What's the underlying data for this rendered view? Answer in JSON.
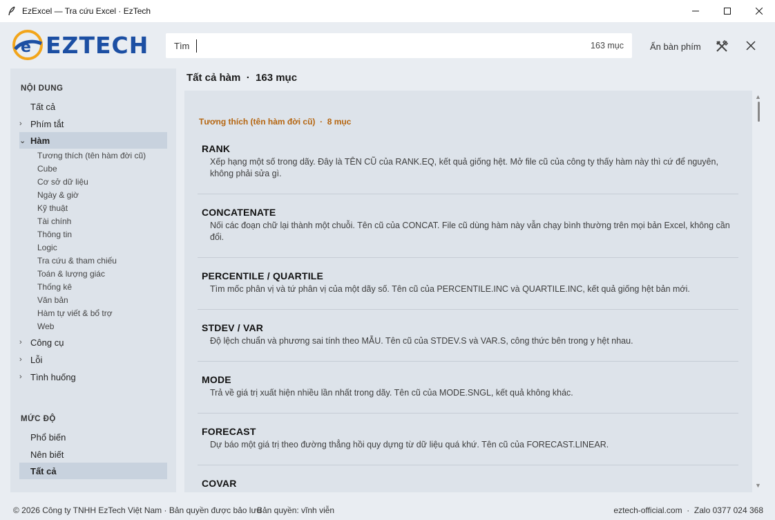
{
  "window": {
    "title": "EzExcel — Tra cứu Excel · EzTech"
  },
  "header": {
    "logo_text": "EZTECH",
    "search_label": "Tìm",
    "search_value": "",
    "search_count": "163 mục",
    "hide_keyboard": "Ẩn bàn phím"
  },
  "sidebar": {
    "content_label": "NỘI DUNG",
    "items": [
      {
        "label": "Tất cả",
        "chevron": ""
      },
      {
        "label": "Phím tắt",
        "chevron": "›"
      },
      {
        "label": "Hàm",
        "chevron": "⌄"
      },
      {
        "label": "Công cụ",
        "chevron": "›"
      },
      {
        "label": "Lỗi",
        "chevron": "›"
      },
      {
        "label": "Tình huống",
        "chevron": "›"
      }
    ],
    "sub_items": [
      "Tương thích (tên hàm đời cũ)",
      "Cube",
      "Cơ sở dữ liệu",
      "Ngày & giờ",
      "Kỹ thuật",
      "Tài chính",
      "Thông tin",
      "Logic",
      "Tra cứu & tham chiếu",
      "Toán & lượng giác",
      "Thống kê",
      "Văn bản",
      "Hàm tự viết & bổ trợ",
      "Web"
    ],
    "level_label": "MỨC ĐỘ",
    "levels": [
      "Phổ biến",
      "Nên biết",
      "Tất cả"
    ]
  },
  "main": {
    "title": "Tất cả hàm  ·  163 mục",
    "group_header": "Tương thích (tên hàm đời cũ)  ·  8 mục",
    "entries": [
      {
        "name": "RANK",
        "desc": "Xếp hạng một số trong dãy. Đây là TÊN CŨ của RANK.EQ, kết quả giống hệt. Mở file cũ của công ty thấy hàm này thì cứ để nguyên, không phải sửa gì."
      },
      {
        "name": "CONCATENATE",
        "desc": "Nối các đoạn chữ lại thành một chuỗi. Tên cũ của CONCAT. File cũ dùng hàm này vẫn chạy bình thường trên mọi bản Excel, không cần đổi."
      },
      {
        "name": "PERCENTILE / QUARTILE",
        "desc": "Tìm mốc phân vị và tứ phân vị của một dãy số. Tên cũ của PERCENTILE.INC và QUARTILE.INC, kết quả giống hệt bản mới."
      },
      {
        "name": "STDEV / VAR",
        "desc": "Độ lệch chuẩn và phương sai tính theo MẪU. Tên cũ của STDEV.S và VAR.S, công thức bên trong y hệt nhau."
      },
      {
        "name": "MODE",
        "desc": "Trả về giá trị xuất hiện nhiều lần nhất trong dãy. Tên cũ của MODE.SNGL, kết quả không khác."
      },
      {
        "name": "FORECAST",
        "desc": "Dự báo một giá trị theo đường thẳng hồi quy dựng từ dữ liệu quá khứ. Tên cũ của FORECAST.LINEAR."
      },
      {
        "name": "COVAR",
        "desc": ""
      }
    ]
  },
  "footer": {
    "copyright": "© 2026 Công ty TNHH EzTech Việt Nam · Bản quyền được bảo lưu",
    "license": "Bản quyền: vĩnh viễn",
    "contact": "eztech-official.com  ·  Zalo 0377 024 368"
  }
}
